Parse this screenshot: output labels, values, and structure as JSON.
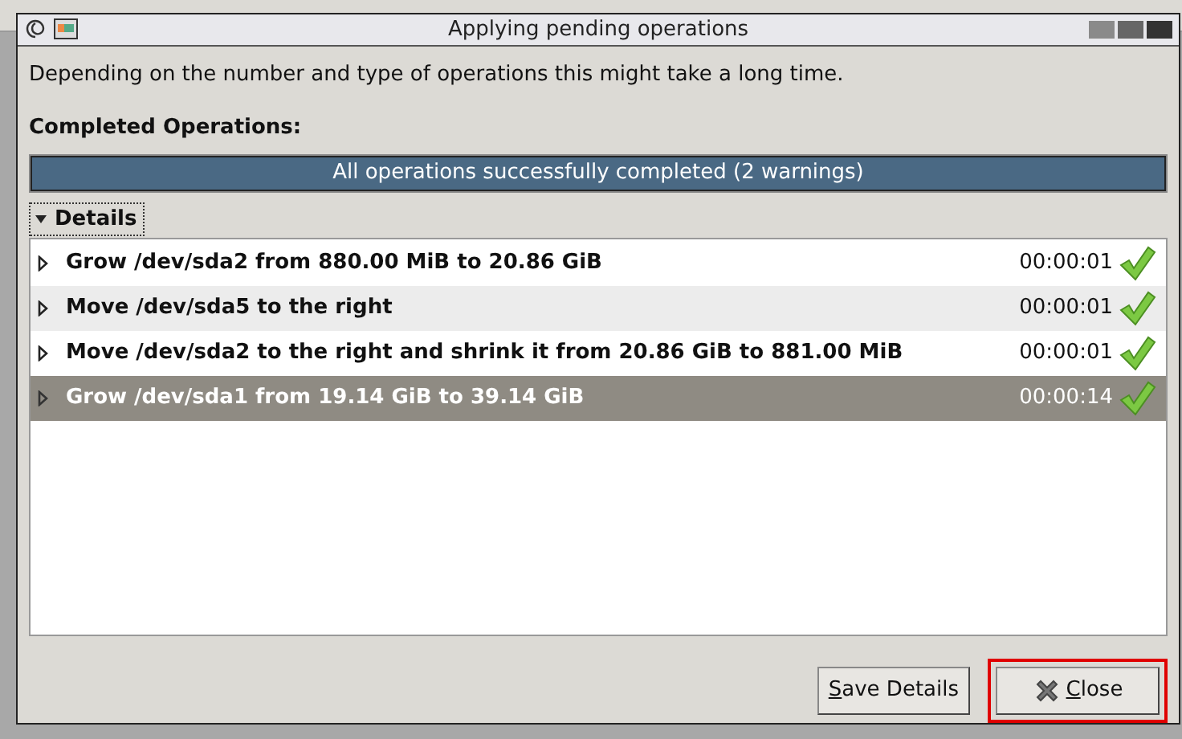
{
  "window": {
    "title": "Applying pending operations"
  },
  "message": "Depending on the number and type of operations this might take a long time.",
  "progress": {
    "label": "Completed Operations:",
    "text": "All operations successfully completed (2 warnings)",
    "level": 1
  },
  "details": {
    "label": "Details",
    "expanded": true
  },
  "operations": [
    {
      "text": "Grow /dev/sda2 from 880.00 MiB to 20.86 GiB",
      "time": "00:00:01",
      "selected": false
    },
    {
      "text": "Move /dev/sda5 to the right",
      "time": "00:00:01",
      "selected": false
    },
    {
      "text": "Move /dev/sda2 to the right and shrink it from 20.86 GiB to 881.00 MiB",
      "time": "00:00:01",
      "selected": false
    },
    {
      "text": "Grow /dev/sda1 from 19.14 GiB to 39.14 GiB",
      "time": "00:00:14",
      "selected": true
    }
  ],
  "buttons": [
    {
      "label": "Save Details",
      "kind": "save"
    },
    {
      "label": "Close",
      "kind": "close",
      "highlighted": true
    }
  ]
}
